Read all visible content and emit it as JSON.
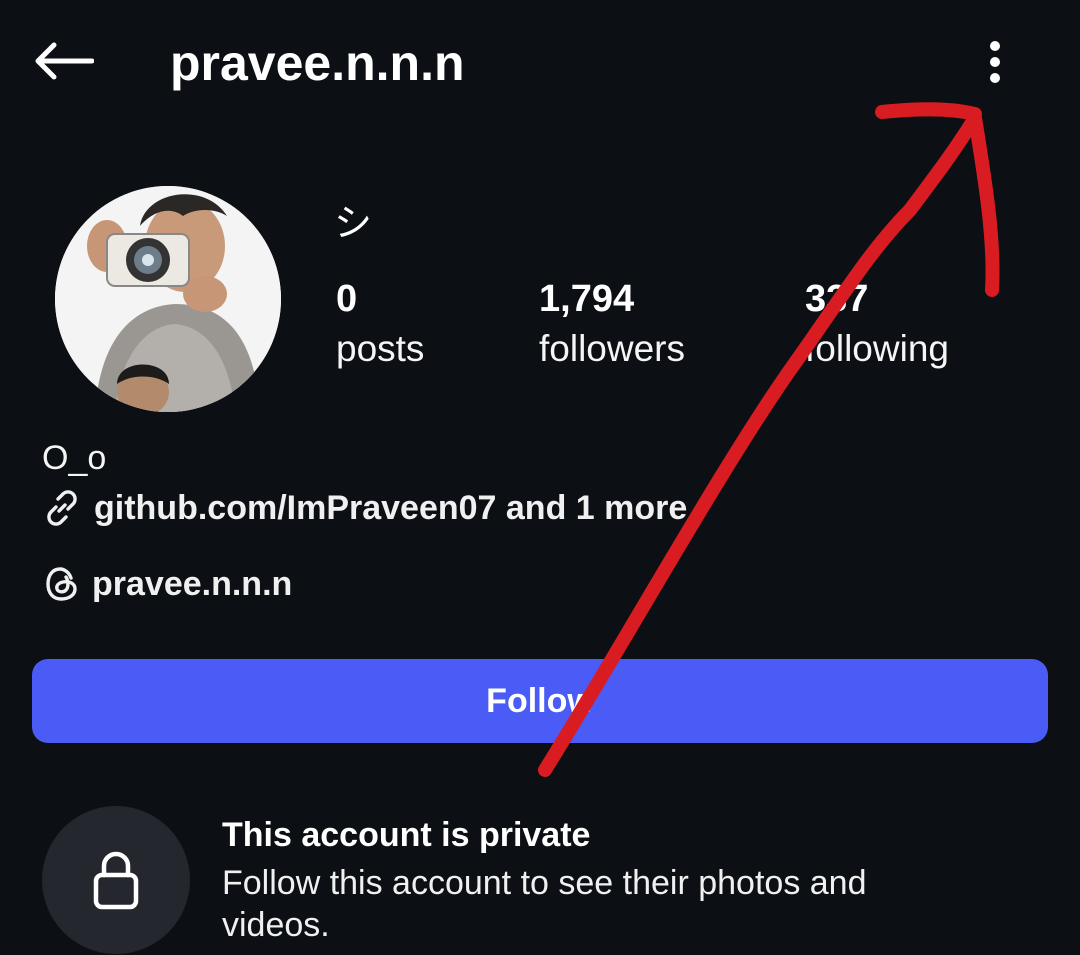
{
  "header": {
    "back_icon": "arrow-left-icon",
    "title": "pravee.n.n.n",
    "more_icon": "more-vertical-icon"
  },
  "profile": {
    "avatar_icon": "avatar-3d-photographer",
    "display_name": "シ",
    "stats": [
      {
        "value": "0",
        "label": "posts"
      },
      {
        "value": "1,794",
        "label": "followers"
      },
      {
        "value": "337",
        "label": "following"
      }
    ],
    "bio": "O_o",
    "link_icon": "link-icon",
    "link_text": "github.com/ImPraveen07 and 1 more",
    "threads_icon": "threads-icon",
    "threads_handle": "pravee.n.n.n"
  },
  "actions": {
    "follow_label": "Follow"
  },
  "private_notice": {
    "lock_icon": "lock-icon",
    "title": "This account is private",
    "description": "Follow this account to see their photos and videos."
  },
  "colors": {
    "background": "#0c0f14",
    "accent": "#4a5cf5",
    "annotation": "#d81c22"
  }
}
